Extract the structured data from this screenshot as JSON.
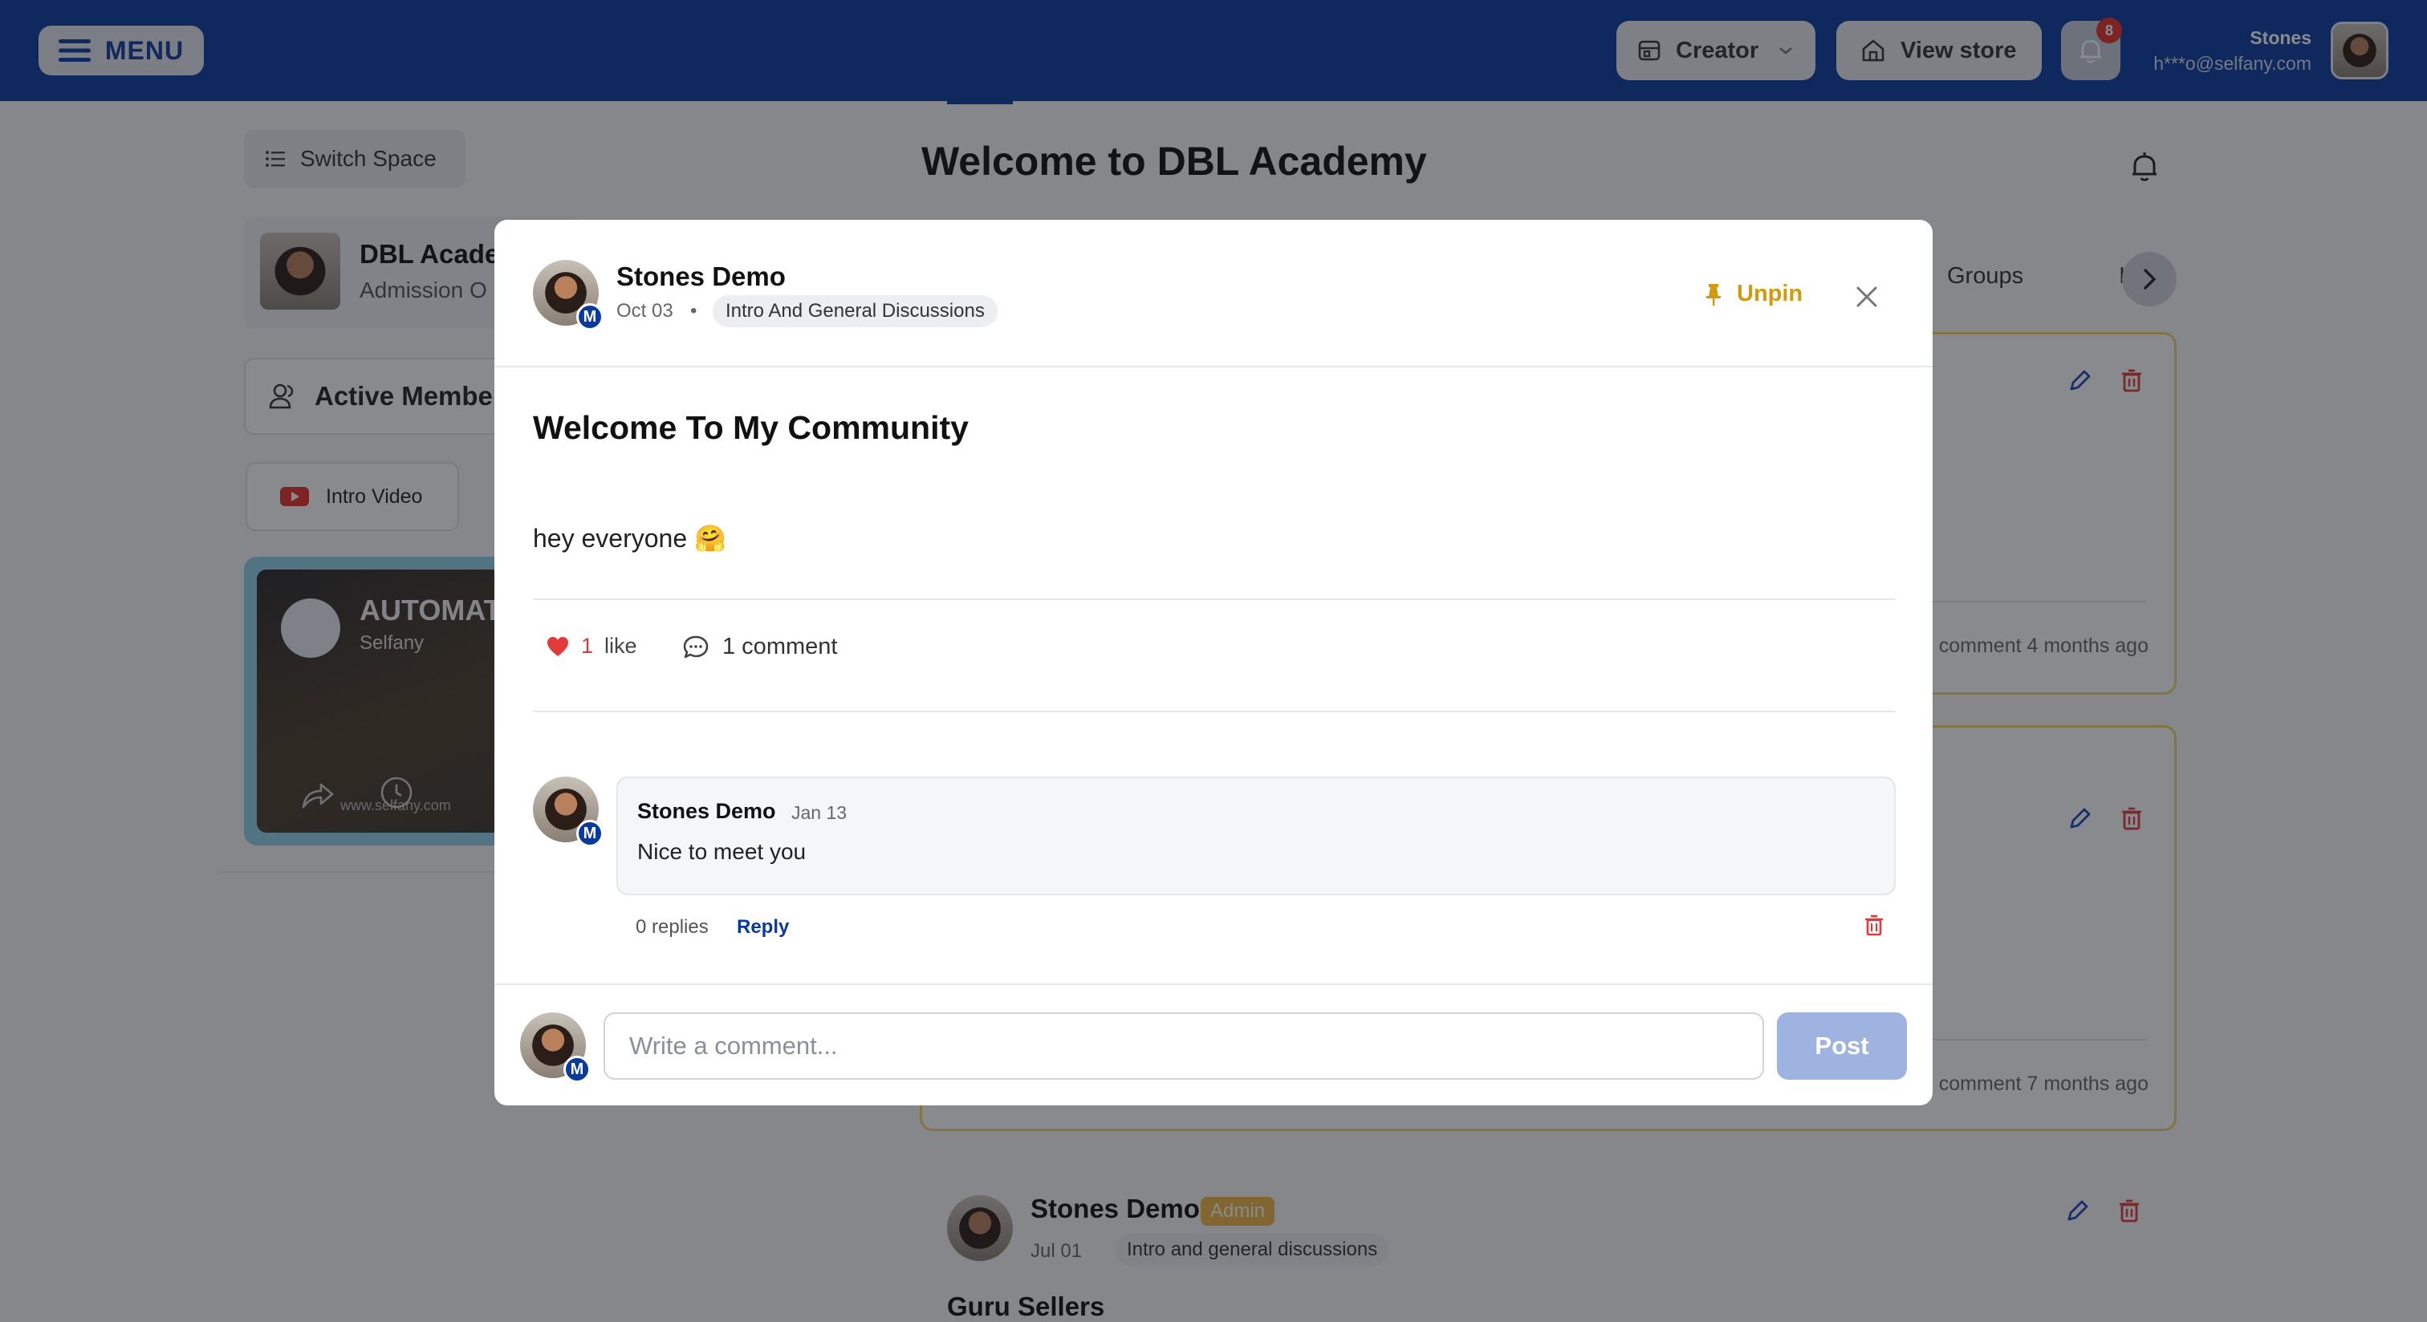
{
  "header": {
    "menu_label": "MENU",
    "creator_label": "Creator",
    "view_store_label": "View store",
    "notification_count": "8",
    "user_name": "Stones",
    "user_email": "h***o@selfany.com"
  },
  "sidebar": {
    "switch_space_label": "Switch Space",
    "space_title": "DBL Acade",
    "space_subtitle": "Admission O",
    "active_members_label": "Active Member",
    "intro_video_label": "Intro Video",
    "video": {
      "title": "AUTOMAT",
      "subtitle": "Selfany",
      "url": "www.selfany.com"
    }
  },
  "main": {
    "title": "Welcome to DBL Academy",
    "tabs": [
      "Groups",
      "I"
    ],
    "cards": [
      {
        "footer": "comment 4 months ago"
      },
      {
        "footer": "comment 7 months ago"
      }
    ],
    "post3": {
      "author": "Stones Demo",
      "badge": "Admin",
      "date": "Jul 01",
      "category": "Intro and general discussions",
      "title": "Guru Sellers"
    }
  },
  "modal": {
    "author": "Stones Demo",
    "author_badge": "M",
    "date": "Oct 03",
    "category": "Intro And General Discussions",
    "unpin_label": "Unpin",
    "title": "Welcome To My Community",
    "body": "hey everyone 🤗",
    "like_count": "1",
    "like_label": "like",
    "comment_label": "1 comment",
    "comment": {
      "author": "Stones Demo",
      "date": "Jan 13",
      "text": "Nice to meet you",
      "replies_label": "0 replies",
      "reply_label": "Reply"
    },
    "composer": {
      "placeholder": "Write a comment...",
      "post_label": "Post"
    }
  },
  "colors": {
    "brand": "#0b3a9e",
    "accent_gold": "#d29b0d",
    "like_red": "#e23a3a"
  }
}
